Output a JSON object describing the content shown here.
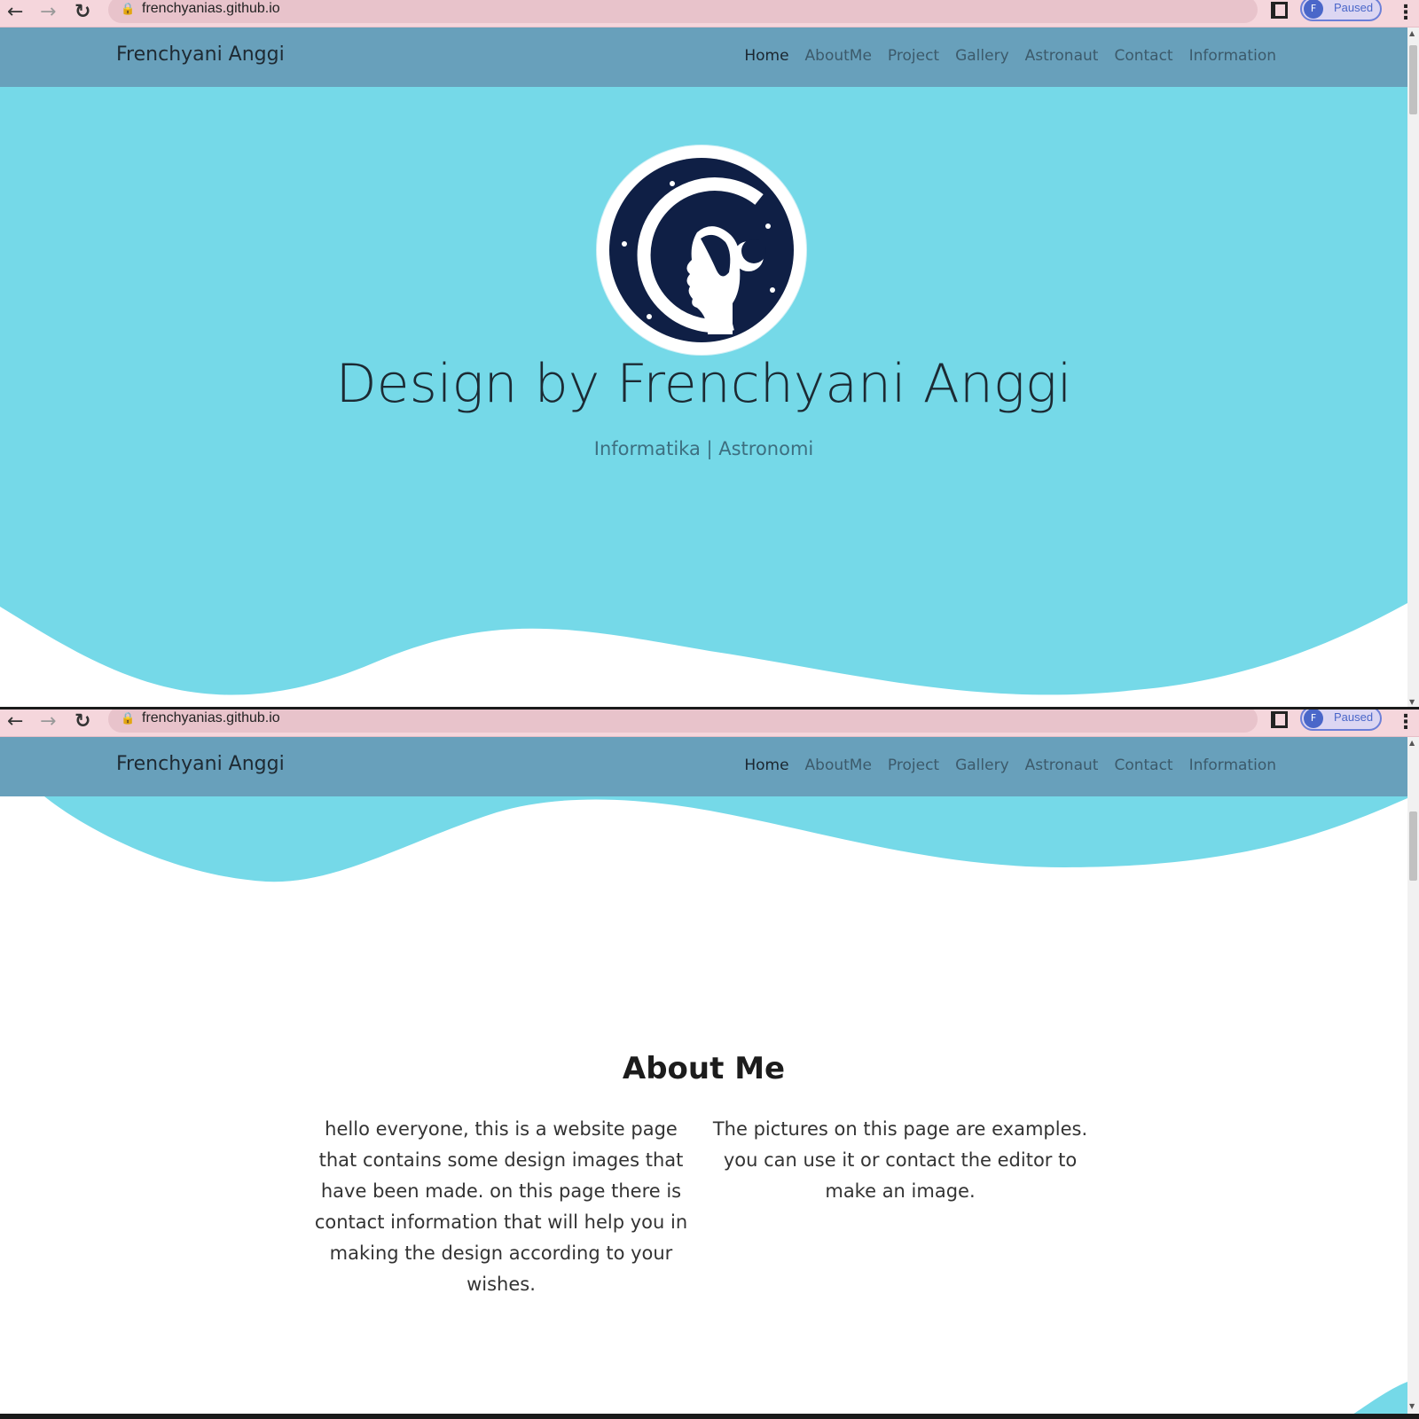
{
  "browser": {
    "url": "frenchyanias.github.io",
    "profile_initial": "F",
    "profile_status": "Paused"
  },
  "navbar": {
    "brand": "Frenchyani Anggi",
    "links": [
      "Home",
      "AboutMe",
      "Project",
      "Gallery",
      "Astronaut",
      "Contact",
      "Information"
    ],
    "active": "Home"
  },
  "hero": {
    "title": "Design by Frenchyani Anggi",
    "subtitle": "Informatika | Astronomi"
  },
  "about": {
    "title": "About Me",
    "left_text": "hello everyone, this is a website page that contains some design images that have been made. on this page there is contact information that will help you in making the design according to your wishes.",
    "right_text": "The pictures on this page are examples. you can use it or contact the editor to make an image."
  },
  "colors": {
    "toolbar": "#f5d6dc",
    "navbar": "#68a0bb",
    "hero": "#75d9e8",
    "logo_bg": "#0f1f45"
  },
  "icons": [
    "back-arrow-icon",
    "forward-arrow-icon",
    "reload-icon",
    "lock-icon",
    "share-icon",
    "star-icon",
    "side-panel-icon",
    "menu-dots-icon",
    "astronaut-girl-logo"
  ]
}
